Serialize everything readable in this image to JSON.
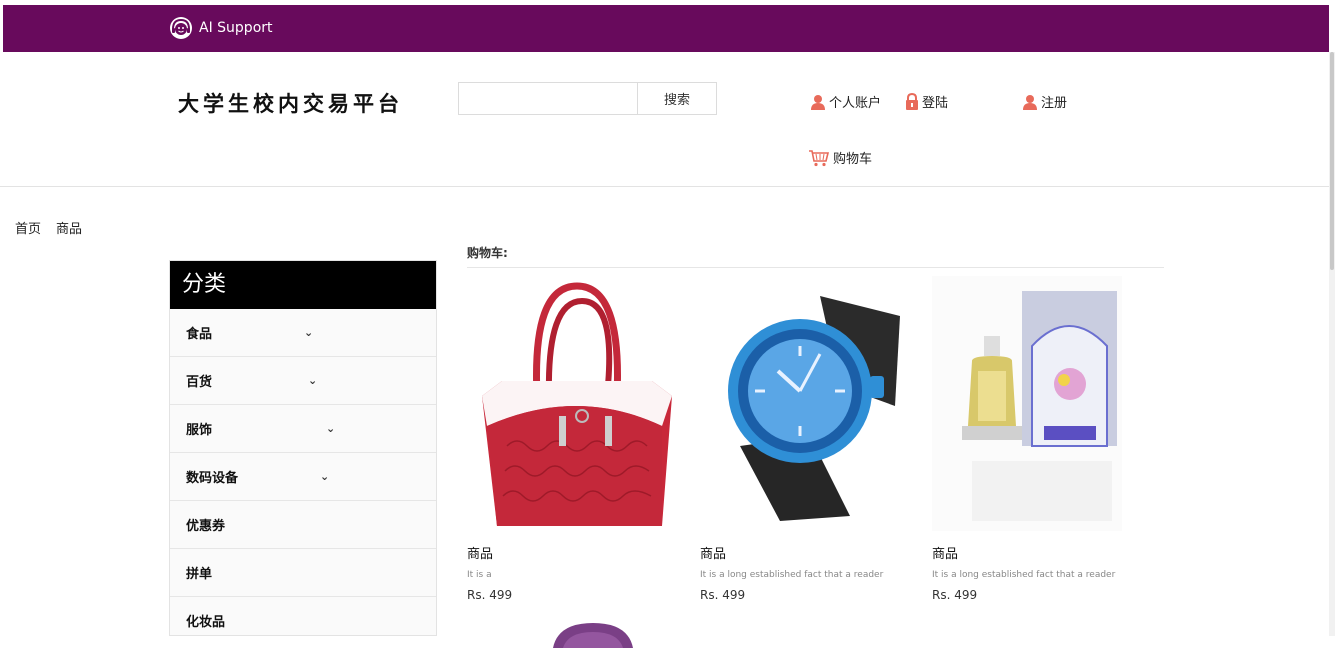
{
  "topbar": {
    "support_label": "AI Support"
  },
  "header": {
    "site_title": "大学生校内交易平台",
    "search_value": "",
    "search_button": "搜索",
    "links": {
      "account": "个人账户",
      "login": "登陆",
      "register": "注册",
      "cart": "购物车"
    }
  },
  "breadcrumb": {
    "home": "首页",
    "current": "商品"
  },
  "sidebar": {
    "title": "分类",
    "items": [
      {
        "label": "食品",
        "has_submenu": true
      },
      {
        "label": "百货",
        "has_submenu": true
      },
      {
        "label": "服饰",
        "has_submenu": true
      },
      {
        "label": "数码设备",
        "has_submenu": true
      },
      {
        "label": "优惠券",
        "has_submenu": false
      },
      {
        "label": "拼单",
        "has_submenu": false
      },
      {
        "label": "化妆品",
        "has_submenu": false
      }
    ]
  },
  "cart_section": {
    "heading": "购物车:"
  },
  "products": [
    {
      "name": "商品",
      "desc": "It is a",
      "price": "Rs. 499"
    },
    {
      "name": "商品",
      "desc": "It is a long established fact that a reader",
      "price": "Rs. 499"
    },
    {
      "name": "商品",
      "desc": "It is a long established fact that a reader",
      "price": "Rs. 499"
    }
  ],
  "colors": {
    "topbar": "#680a5c",
    "icon_accent": "#e86a5a",
    "sidebar_header": "#000000"
  }
}
